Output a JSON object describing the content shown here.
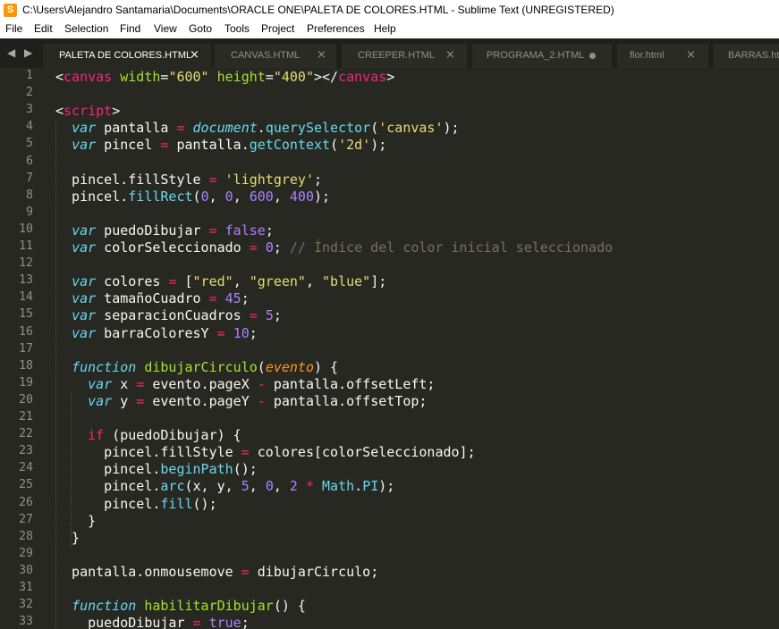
{
  "window": {
    "title": "C:\\Users\\Alejandro Santamaria\\Documents\\ORACLE ONE\\PALETA DE COLORES.HTML - Sublime Text (UNREGISTERED)",
    "app_icon_glyph": "S"
  },
  "menu": [
    "File",
    "Edit",
    "Selection",
    "Find",
    "View",
    "Goto",
    "Tools",
    "Project",
    "Preferences",
    "Help"
  ],
  "tab_nav_glyph": "◀ ▶",
  "tabs": [
    {
      "label": "PALETA DE COLORES.HTML",
      "active": true,
      "state": "close",
      "close_glyph": "×"
    },
    {
      "label": "CANVAS.HTML",
      "active": false,
      "state": "close",
      "close_glyph": "×"
    },
    {
      "label": "CREEPER.HTML",
      "active": false,
      "state": "close",
      "close_glyph": "×"
    },
    {
      "label": "PROGRAMA_2.HTML",
      "active": false,
      "state": "dirty",
      "close_glyph": ""
    },
    {
      "label": "flor.html",
      "active": false,
      "state": "close",
      "close_glyph": "×"
    },
    {
      "label": "BARRAS.htm",
      "active": false,
      "state": "none",
      "close_glyph": ""
    }
  ],
  "editor": {
    "line_numbers": [
      "1",
      "2",
      "3",
      "4",
      "5",
      "6",
      "7",
      "8",
      "9",
      "10",
      "11",
      "12",
      "13",
      "14",
      "15",
      "16",
      "17",
      "18",
      "19",
      "20",
      "21",
      "22",
      "23",
      "24",
      "25",
      "26",
      "27",
      "28",
      "29",
      "30",
      "31",
      "32",
      "33"
    ],
    "lines": [
      [
        [
          "c-plain",
          "<"
        ],
        [
          "c-tag",
          "canvas"
        ],
        [
          "c-plain",
          " "
        ],
        [
          "c-attr",
          "width"
        ],
        [
          "c-plain",
          "="
        ],
        [
          "c-str",
          "\"600\""
        ],
        [
          "c-plain",
          " "
        ],
        [
          "c-attr",
          "height"
        ],
        [
          "c-plain",
          "="
        ],
        [
          "c-str",
          "\"400\""
        ],
        [
          "c-plain",
          "></"
        ],
        [
          "c-tag",
          "canvas"
        ],
        [
          "c-plain",
          ">"
        ]
      ],
      [],
      [
        [
          "c-plain",
          "<"
        ],
        [
          "c-tag",
          "script"
        ],
        [
          "c-plain",
          ">"
        ]
      ],
      [
        [
          "c-plain",
          "  "
        ],
        [
          "c-kw",
          "var"
        ],
        [
          "c-plain",
          " pantalla "
        ],
        [
          "c-op",
          "="
        ],
        [
          "c-plain",
          " "
        ],
        [
          "c-kw",
          "document"
        ],
        [
          "c-plain",
          "."
        ],
        [
          "c-fn",
          "querySelector"
        ],
        [
          "c-plain",
          "("
        ],
        [
          "c-str",
          "'canvas'"
        ],
        [
          "c-plain",
          ");"
        ]
      ],
      [
        [
          "c-plain",
          "  "
        ],
        [
          "c-kw",
          "var"
        ],
        [
          "c-plain",
          " pincel "
        ],
        [
          "c-op",
          "="
        ],
        [
          "c-plain",
          " pantalla."
        ],
        [
          "c-fn",
          "getContext"
        ],
        [
          "c-plain",
          "("
        ],
        [
          "c-str",
          "'2d'"
        ],
        [
          "c-plain",
          ");"
        ]
      ],
      [],
      [
        [
          "c-plain",
          "  pincel.fillStyle "
        ],
        [
          "c-op",
          "="
        ],
        [
          "c-plain",
          " "
        ],
        [
          "c-str",
          "'lightgrey'"
        ],
        [
          "c-plain",
          ";"
        ]
      ],
      [
        [
          "c-plain",
          "  pincel."
        ],
        [
          "c-fn",
          "fillRect"
        ],
        [
          "c-plain",
          "("
        ],
        [
          "c-num",
          "0"
        ],
        [
          "c-plain",
          ", "
        ],
        [
          "c-num",
          "0"
        ],
        [
          "c-plain",
          ", "
        ],
        [
          "c-num",
          "600"
        ],
        [
          "c-plain",
          ", "
        ],
        [
          "c-num",
          "400"
        ],
        [
          "c-plain",
          ");"
        ]
      ],
      [],
      [
        [
          "c-plain",
          "  "
        ],
        [
          "c-kw",
          "var"
        ],
        [
          "c-plain",
          " puedoDibujar "
        ],
        [
          "c-op",
          "="
        ],
        [
          "c-plain",
          " "
        ],
        [
          "c-num",
          "false"
        ],
        [
          "c-plain",
          ";"
        ]
      ],
      [
        [
          "c-plain",
          "  "
        ],
        [
          "c-kw",
          "var"
        ],
        [
          "c-plain",
          " colorSeleccionado "
        ],
        [
          "c-op",
          "="
        ],
        [
          "c-plain",
          " "
        ],
        [
          "c-num",
          "0"
        ],
        [
          "c-plain",
          "; "
        ],
        [
          "c-cm",
          "// Índice del color inicial seleccionado"
        ]
      ],
      [],
      [
        [
          "c-plain",
          "  "
        ],
        [
          "c-kw",
          "var"
        ],
        [
          "c-plain",
          " colores "
        ],
        [
          "c-op",
          "="
        ],
        [
          "c-plain",
          " ["
        ],
        [
          "c-str",
          "\"red\""
        ],
        [
          "c-plain",
          ", "
        ],
        [
          "c-str",
          "\"green\""
        ],
        [
          "c-plain",
          ", "
        ],
        [
          "c-str",
          "\"blue\""
        ],
        [
          "c-plain",
          "];"
        ]
      ],
      [
        [
          "c-plain",
          "  "
        ],
        [
          "c-kw",
          "var"
        ],
        [
          "c-plain",
          " tamañoCuadro "
        ],
        [
          "c-op",
          "="
        ],
        [
          "c-plain",
          " "
        ],
        [
          "c-num",
          "45"
        ],
        [
          "c-plain",
          ";"
        ]
      ],
      [
        [
          "c-plain",
          "  "
        ],
        [
          "c-kw",
          "var"
        ],
        [
          "c-plain",
          " separacionCuadros "
        ],
        [
          "c-op",
          "="
        ],
        [
          "c-plain",
          " "
        ],
        [
          "c-num",
          "5"
        ],
        [
          "c-plain",
          ";"
        ]
      ],
      [
        [
          "c-plain",
          "  "
        ],
        [
          "c-kw",
          "var"
        ],
        [
          "c-plain",
          " barraColoresY "
        ],
        [
          "c-op",
          "="
        ],
        [
          "c-plain",
          " "
        ],
        [
          "c-num",
          "10"
        ],
        [
          "c-plain",
          ";"
        ]
      ],
      [],
      [
        [
          "c-plain",
          "  "
        ],
        [
          "c-kw",
          "function"
        ],
        [
          "c-plain",
          " "
        ],
        [
          "c-fdef",
          "dibujarCirculo"
        ],
        [
          "c-plain",
          "("
        ],
        [
          "c-param",
          "evento"
        ],
        [
          "c-plain",
          ") {"
        ]
      ],
      [
        [
          "c-plain",
          "    "
        ],
        [
          "c-kw",
          "var"
        ],
        [
          "c-plain",
          " x "
        ],
        [
          "c-op",
          "="
        ],
        [
          "c-plain",
          " evento.pageX "
        ],
        [
          "c-op",
          "-"
        ],
        [
          "c-plain",
          " pantalla.offsetLeft;"
        ]
      ],
      [
        [
          "c-plain",
          "    "
        ],
        [
          "c-kw",
          "var"
        ],
        [
          "c-plain",
          " y "
        ],
        [
          "c-op",
          "="
        ],
        [
          "c-plain",
          " evento.pageY "
        ],
        [
          "c-op",
          "-"
        ],
        [
          "c-plain",
          " pantalla.offsetTop;"
        ]
      ],
      [],
      [
        [
          "c-plain",
          "    "
        ],
        [
          "c-kw2",
          "if"
        ],
        [
          "c-plain",
          " (puedoDibujar) {"
        ]
      ],
      [
        [
          "c-plain",
          "      pincel.fillStyle "
        ],
        [
          "c-op",
          "="
        ],
        [
          "c-plain",
          " colores[colorSeleccionado];"
        ]
      ],
      [
        [
          "c-plain",
          "      pincel."
        ],
        [
          "c-fn",
          "beginPath"
        ],
        [
          "c-plain",
          "();"
        ]
      ],
      [
        [
          "c-plain",
          "      pincel."
        ],
        [
          "c-fn",
          "arc"
        ],
        [
          "c-plain",
          "(x, y, "
        ],
        [
          "c-num",
          "5"
        ],
        [
          "c-plain",
          ", "
        ],
        [
          "c-num",
          "0"
        ],
        [
          "c-plain",
          ", "
        ],
        [
          "c-num",
          "2"
        ],
        [
          "c-plain",
          " "
        ],
        [
          "c-op",
          "*"
        ],
        [
          "c-plain",
          " "
        ],
        [
          "c-fn",
          "Math"
        ],
        [
          "c-plain",
          "."
        ],
        [
          "c-fn",
          "PI"
        ],
        [
          "c-plain",
          ");"
        ]
      ],
      [
        [
          "c-plain",
          "      pincel."
        ],
        [
          "c-fn",
          "fill"
        ],
        [
          "c-plain",
          "();"
        ]
      ],
      [
        [
          "c-plain",
          "    }"
        ]
      ],
      [
        [
          "c-plain",
          "  }"
        ]
      ],
      [],
      [
        [
          "c-plain",
          "  pantalla.onmousemove "
        ],
        [
          "c-op",
          "="
        ],
        [
          "c-plain",
          " dibujarCirculo;"
        ]
      ],
      [],
      [
        [
          "c-plain",
          "  "
        ],
        [
          "c-kw",
          "function"
        ],
        [
          "c-plain",
          " "
        ],
        [
          "c-fdef",
          "habilitarDibujar"
        ],
        [
          "c-plain",
          "() {"
        ]
      ],
      [
        [
          "c-plain",
          "    puedoDibujar "
        ],
        [
          "c-op",
          "="
        ],
        [
          "c-plain",
          " "
        ],
        [
          "c-num",
          "true"
        ],
        [
          "c-plain",
          ";"
        ]
      ]
    ]
  }
}
